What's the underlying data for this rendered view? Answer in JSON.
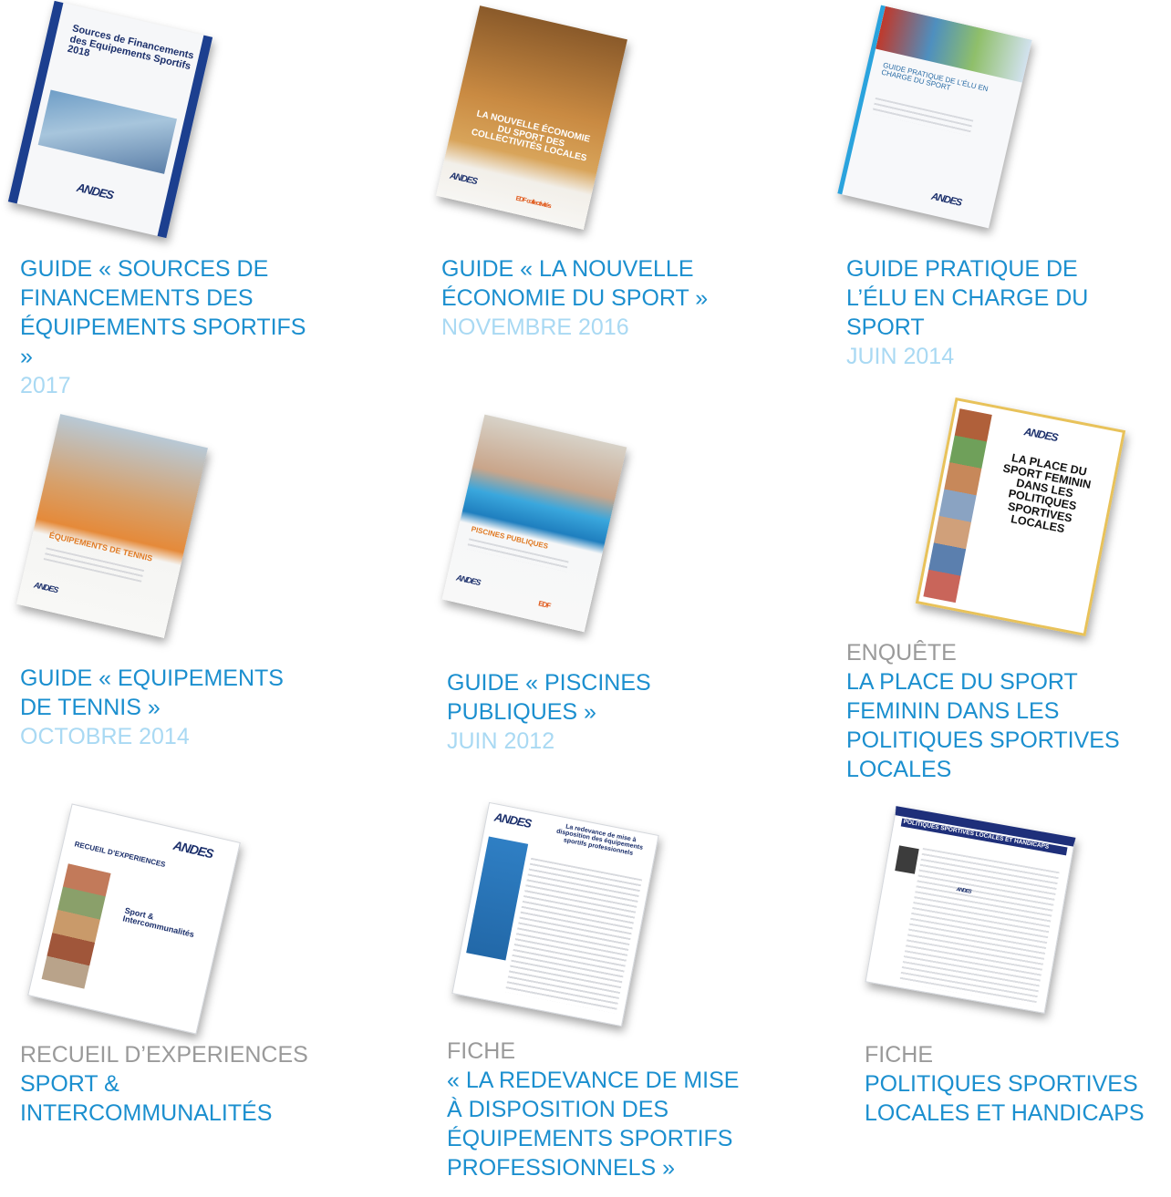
{
  "items": [
    {
      "kind": "",
      "title": "GUIDE « SOURCES DE FINANCEMENTS DES ÉQUIPEMENTS SPORTIFS »",
      "date": "2017",
      "cover": {
        "title": "Sources de Financements des Equipements Sportifs 2018",
        "logo": "ANDES"
      }
    },
    {
      "kind": "",
      "title": "GUIDE « LA NOUVELLE ÉCONOMIE DU SPORT »",
      "date": "NOVEMBRE 2016",
      "cover": {
        "title": "LA NOUVELLE ÉCONOMIE DU SPORT DES COLLECTIVITÉS LOCALES",
        "logo": "ANDES",
        "partner": "EDF collectivités"
      }
    },
    {
      "kind": "",
      "title": "GUIDE PRATIQUE DE L’ÉLU EN CHARGE DU SPORT",
      "date": "JUIN 2014",
      "cover": {
        "title": "GUIDE PRATIQUE DE L’ÉLU EN CHARGE DU SPORT",
        "logo": "ANDES"
      }
    },
    {
      "kind": "",
      "title": "GUIDE « EQUIPEMENTS DE TENNIS »",
      "date": "OCTOBRE 2014",
      "cover": {
        "title": "ÉQUIPEMENTS DE TENNIS",
        "logo": "ANDES"
      }
    },
    {
      "kind": "",
      "title": "GUIDE « PISCINES PUBLIQUES »",
      "date": "JUIN 2012",
      "cover": {
        "title": "PISCINES PUBLIQUES",
        "logo": "ANDES",
        "partner": "EDF"
      }
    },
    {
      "kind": "ENQUÊTE",
      "title": "LA PLACE DU SPORT FEMININ DANS LES POLITIQUES SPORTIVES LOCALES",
      "date": "",
      "cover": {
        "title": "LA PLACE DU SPORT FEMININ DANS LES POLITIQUES SPORTIVES LOCALES",
        "logo": "ANDES"
      }
    },
    {
      "kind": "RECUEIL D’EXPERIENCES",
      "title": "SPORT & INTERCOMMUNALITÉS",
      "date": "",
      "cover": {
        "title": "RECUEIL D’EXPERIENCES",
        "subtitle": "Sport & Intercommunalités",
        "logo": "ANDES"
      }
    },
    {
      "kind": "FICHE",
      "title": "« LA REDEVANCE DE MISE À DISPOSITION DES ÉQUIPEMENTS SPORTIFS PROFESSIONNELS »",
      "date": "",
      "cover": {
        "title": "La redevance de mise à disposition des équipements sportifs professionnels",
        "logo": "ANDES"
      }
    },
    {
      "kind": "FICHE",
      "title": "POLITIQUES SPORTIVES LOCALES ET HANDICAPS",
      "date": "",
      "cover": {
        "title": "POLITIQUES SPORTIVES LOCALES ET HANDICAPS",
        "logo": "ANDES"
      }
    }
  ]
}
